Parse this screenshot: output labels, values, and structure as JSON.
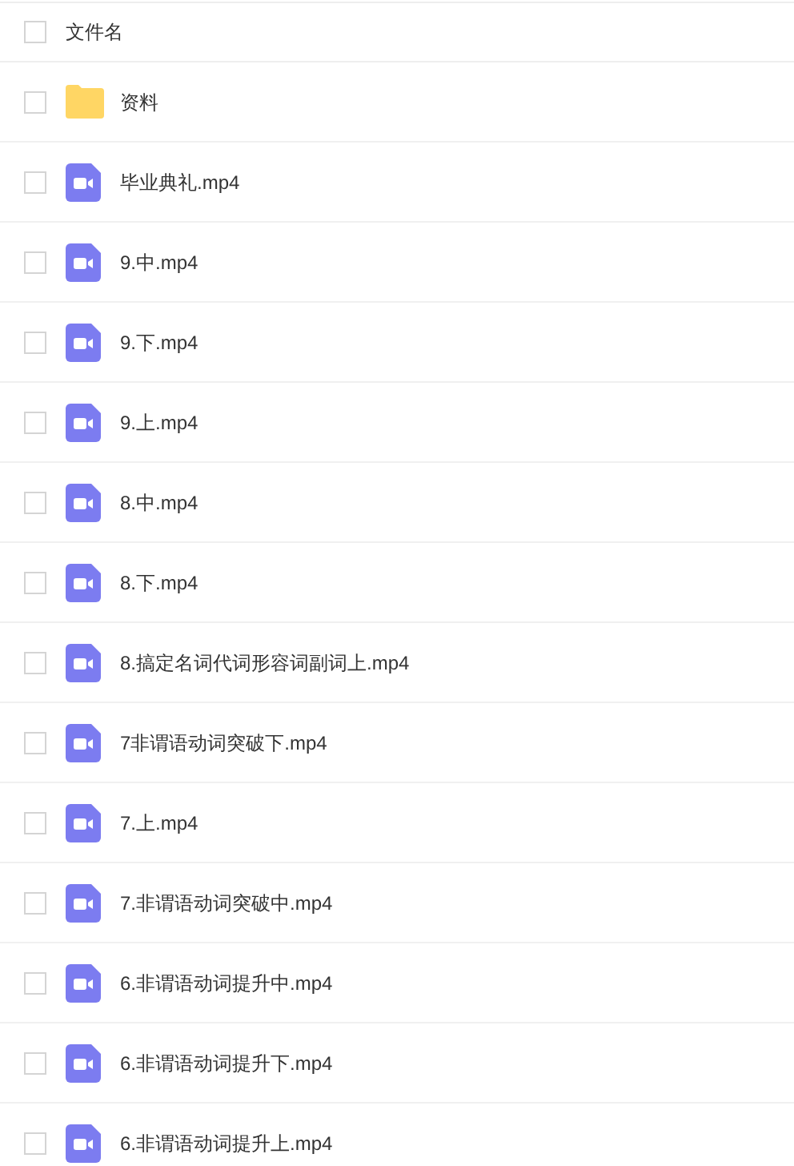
{
  "header": {
    "checked": false,
    "label": "文件名"
  },
  "files": [
    {
      "kind": "folder",
      "name": "资料",
      "checked": false
    },
    {
      "kind": "video",
      "name": "毕业典礼.mp4",
      "checked": false
    },
    {
      "kind": "video",
      "name": "9.中.mp4",
      "checked": false
    },
    {
      "kind": "video",
      "name": "9.下.mp4",
      "checked": false
    },
    {
      "kind": "video",
      "name": "9.上.mp4",
      "checked": false
    },
    {
      "kind": "video",
      "name": "8.中.mp4",
      "checked": false
    },
    {
      "kind": "video",
      "name": "8.下.mp4",
      "checked": false
    },
    {
      "kind": "video",
      "name": "8.搞定名词代词形容词副词上.mp4",
      "checked": false
    },
    {
      "kind": "video",
      "name": "7非谓语动词突破下.mp4",
      "checked": false
    },
    {
      "kind": "video",
      "name": "7.上.mp4",
      "checked": false
    },
    {
      "kind": "video",
      "name": "7.非谓语动词突破中.mp4",
      "checked": false
    },
    {
      "kind": "video",
      "name": "6.非谓语动词提升中.mp4",
      "checked": false
    },
    {
      "kind": "video",
      "name": "6.非谓语动词提升下.mp4",
      "checked": false
    },
    {
      "kind": "video",
      "name": "6.非谓语动词提升上.mp4",
      "checked": false
    }
  ]
}
